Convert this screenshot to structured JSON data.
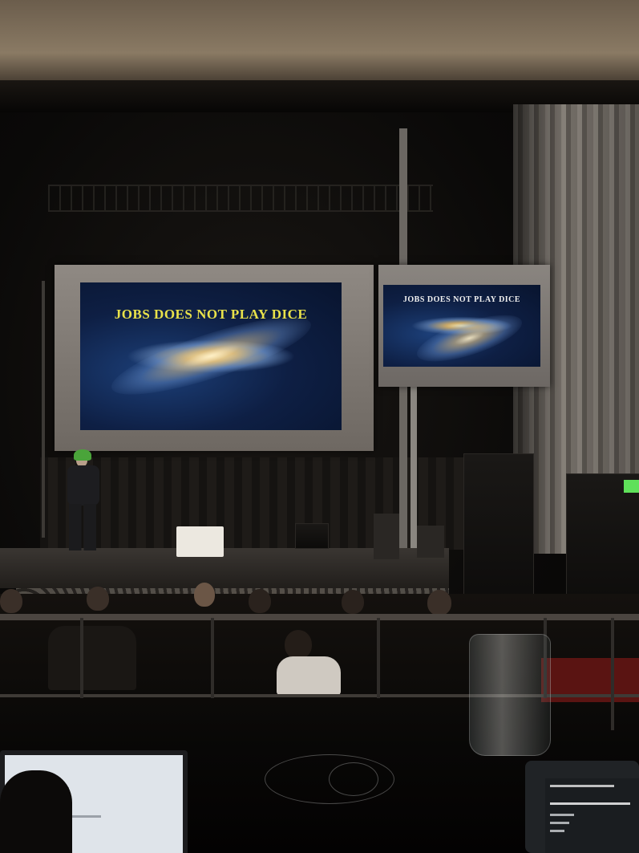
{
  "scene": "photo",
  "main_screen": {
    "slide_text": "JOBS DOES NOT PLAY DICE"
  },
  "side_screen": {
    "slide_text": "JOBS DOES NOT PLAY DICE"
  },
  "colors": {
    "slide_text": "#e9e24a",
    "hat": "#4aa43a",
    "stage_dark": "#050403"
  }
}
